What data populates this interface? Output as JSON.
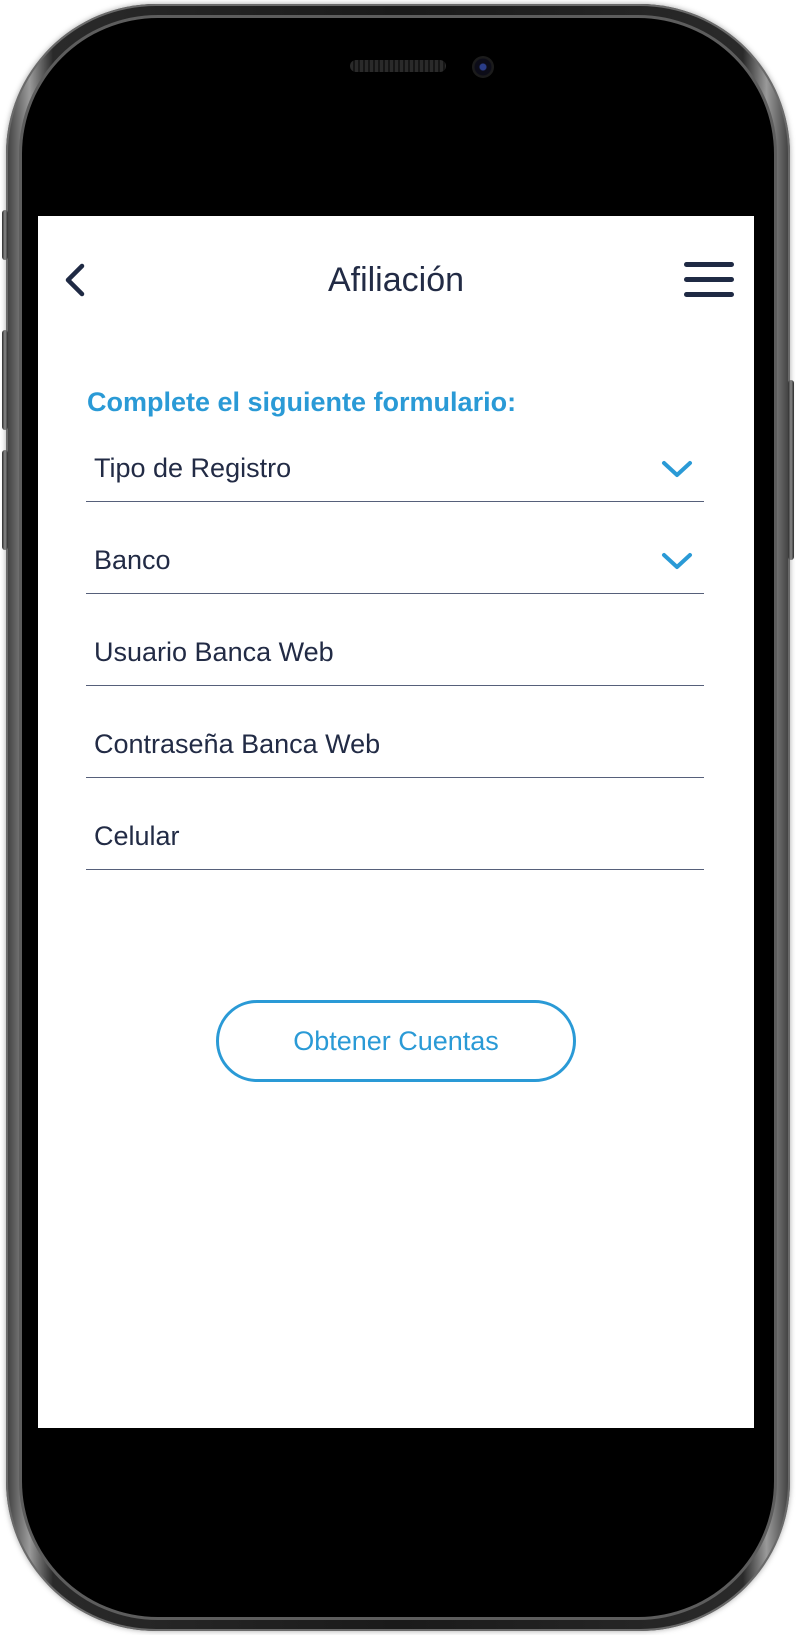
{
  "header": {
    "title": "Afiliación",
    "back_icon": "chevron-left-icon",
    "menu_icon": "hamburger-menu-icon"
  },
  "form": {
    "heading": "Complete el siguiente formulario:",
    "fields": [
      {
        "label": "Tipo de Registro",
        "type": "select",
        "icon": "chevron-down-icon"
      },
      {
        "label": "Banco",
        "type": "select",
        "icon": "chevron-down-icon"
      },
      {
        "label": "Usuario Banca Web",
        "type": "text"
      },
      {
        "label": "Contraseña Banca Web",
        "type": "password"
      },
      {
        "label": "Celular",
        "type": "tel"
      }
    ],
    "submit_label": "Obtener Cuentas"
  },
  "colors": {
    "accent": "#2a9ad6",
    "text_dark": "#222b45",
    "underline": "#56607a"
  }
}
